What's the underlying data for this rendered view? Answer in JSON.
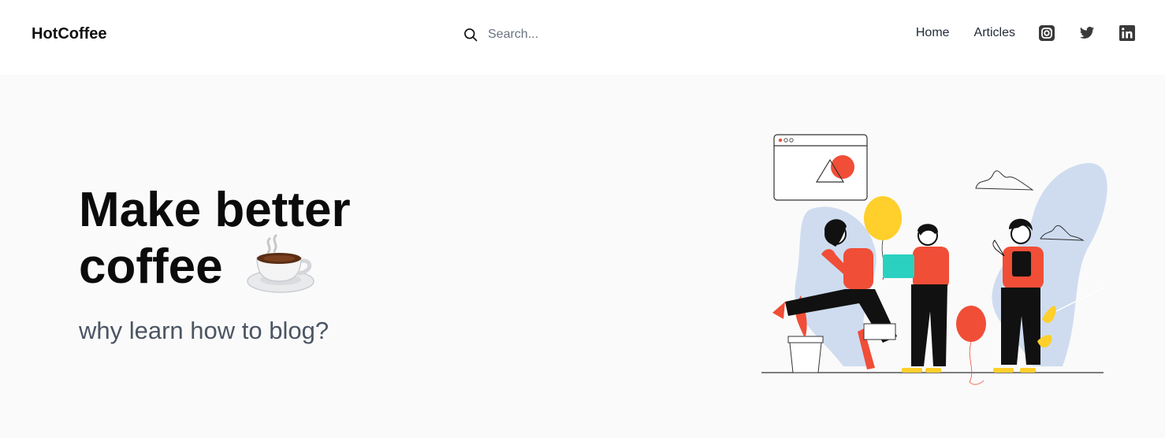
{
  "header": {
    "brand": "HotCoffee",
    "search": {
      "placeholder": "Search..."
    },
    "nav": {
      "home": "Home",
      "articles": "Articles"
    },
    "social_icons": [
      "instagram-icon",
      "twitter-icon",
      "linkedin-icon"
    ]
  },
  "hero": {
    "title_line1": "Make better",
    "title_line2": "coffee",
    "subtitle": "why learn how to blog?"
  },
  "colors": {
    "accent_red": "#f04e37",
    "balloon_yellow": "#ffcf2b",
    "blob_blue": "#cfdcf0",
    "teal": "#2ad1c0",
    "text_dark": "#111111",
    "text_muted": "#4b5563"
  }
}
